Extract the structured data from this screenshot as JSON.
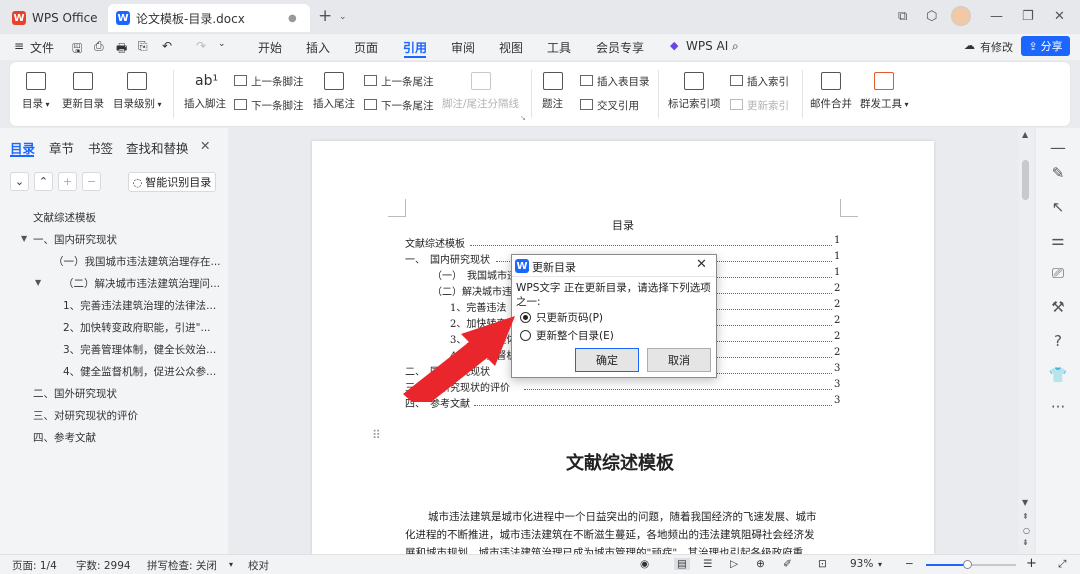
{
  "titlebar": {
    "app_tab": "WPS Office",
    "doc_tab": "论文模板-目录.docx"
  },
  "menu": {
    "file": "文件",
    "tabs": [
      "开始",
      "插入",
      "页面",
      "引用",
      "审阅",
      "视图",
      "工具",
      "会员专享",
      "WPS AI"
    ],
    "active_tab": "引用",
    "edit_mode": "有修改",
    "share": "分享"
  },
  "ribbon": {
    "toc": "目录",
    "update_toc": "更新目录",
    "toc_level": "目录级别",
    "insert_footnote": "插入脚注",
    "prev_footnote": "上一条脚注",
    "next_footnote": "下一条脚注",
    "insert_endnote": "插入尾注",
    "prev_endnote": "上一条尾注",
    "next_endnote": "下一条尾注",
    "footnote_separator": "脚注/尾注分隔线",
    "caption": "题注",
    "insert_table_of_figures": "插入表目录",
    "cross_reference": "交叉引用",
    "mark_index_entry": "标记索引项",
    "insert_index": "插入索引",
    "update_index": "更新索引",
    "mail_merge": "邮件合并",
    "mass_tools": "群发工具"
  },
  "sidebar": {
    "tabs": [
      "目录",
      "章节",
      "书签",
      "查找和替换"
    ],
    "smart_toc": "智能识别目录",
    "items": [
      "文献综述模板",
      "一、国内研究现状",
      "（一）我国城市违法建筑治理存在...",
      "（二）解决城市违法建筑治理问...",
      "1、完善违法建筑治理的法律法...",
      "2、加快转变政府职能，引进\"...",
      "3、完善管理体制，健全长效治...",
      "4、健全监督机制，促进公众参...",
      "二、国外研究现状",
      "三、对研究现状的评价",
      "四、参考文献"
    ]
  },
  "document": {
    "toc_heading": "目录",
    "toc_lines": [
      {
        "text": "文献综述模板",
        "page": "1"
      },
      {
        "text": "一、　国内研究现状",
        "page": "1"
      },
      {
        "text": "（一）　我国城市违",
        "page": "1"
      },
      {
        "text": "（二）解决城市违",
        "page": "2"
      },
      {
        "text": "1、完善违法",
        "page": "2"
      },
      {
        "text": "2、加快转变",
        "page": "2"
      },
      {
        "text": "3、完善管理体",
        "page": "2"
      },
      {
        "text": "4、健全监督机",
        "page": "2"
      },
      {
        "text": "二、　国外研究现状",
        "page": "3"
      },
      {
        "text": "三、　对研究现状的评价",
        "page": "3"
      },
      {
        "text": "四、　参考文献",
        "page": "3"
      }
    ],
    "title": "文献综述模板",
    "body_lines": [
      "城市违法建筑是城市化进程中一个日益突出的问题，随着我国经济的飞速发展、城市",
      "化进程的不断推进，城市违法建筑在不断滋生蔓延，各地频出的违法建筑阻碍社会经济发",
      "展和城市规划，城市违法建筑治理已成为城市管理的\"顽症\"，其治理也引起各级政府重"
    ]
  },
  "dialog": {
    "title": "更新目录",
    "message": "WPS文字 正在更新目录，请选择下列选项之一:",
    "option_page_numbers": "只更新页码(P)",
    "option_entire_toc": "更新整个目录(E)",
    "selected": "只更新页码(P)",
    "ok": "确定",
    "cancel": "取消"
  },
  "status": {
    "page": "页面: 1/4",
    "words": "字数: 2994",
    "spell_check": "拼写检查: 关闭",
    "proofread": "校对",
    "zoom": "93%"
  },
  "colors": {
    "accent": "#1a66ff",
    "wps_red": "#e8412c",
    "arrow_red": "#e8262c"
  }
}
